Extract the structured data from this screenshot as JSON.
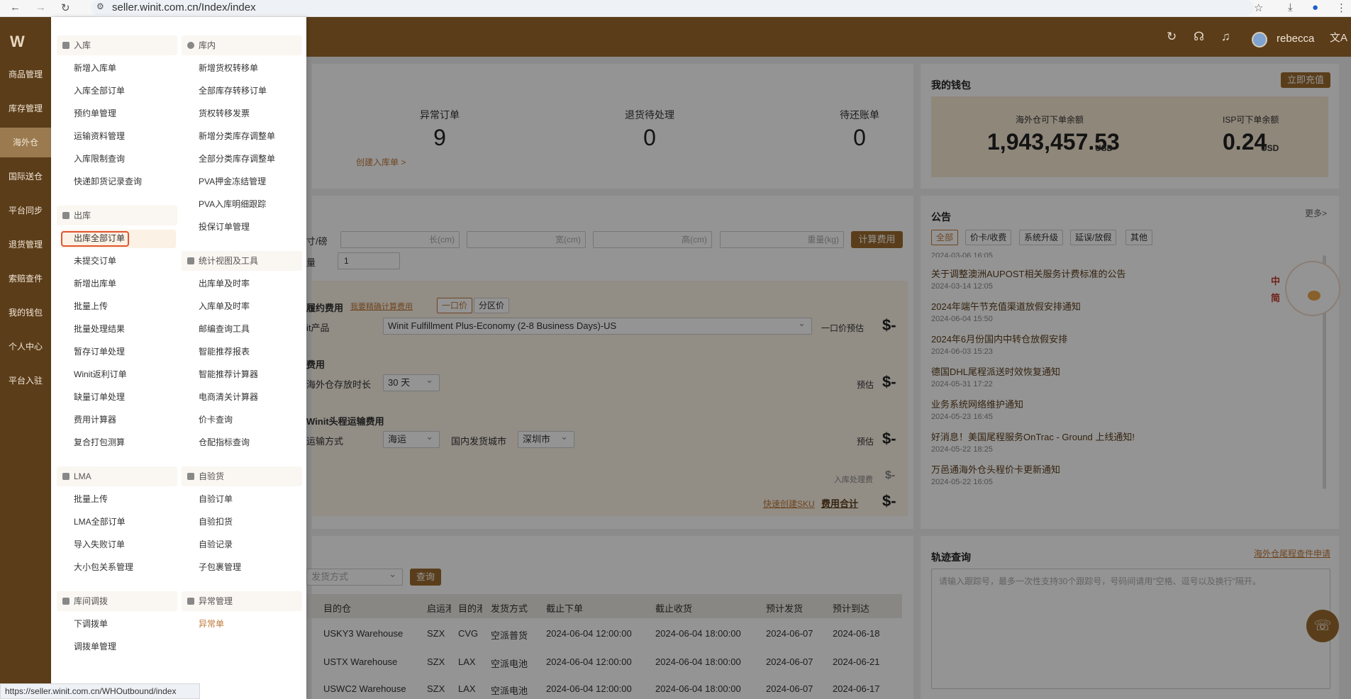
{
  "browser": {
    "url": "seller.winit.com.cn/Index/index"
  },
  "header": {
    "username": "rebecca"
  },
  "sidebar": {
    "logo": "W",
    "items": [
      {
        "label": "商品管理"
      },
      {
        "label": "库存管理"
      },
      {
        "label": "海外仓"
      },
      {
        "label": "国际送仓"
      },
      {
        "label": "平台同步"
      },
      {
        "label": "退货管理"
      },
      {
        "label": "索赔查件"
      },
      {
        "label": "我的钱包"
      },
      {
        "label": "个人中心"
      },
      {
        "label": "平台入驻"
      }
    ]
  },
  "menu": {
    "inbound": {
      "title": "入库",
      "items": [
        "新增入库单",
        "入库全部订单",
        "预约单管理",
        "运输资料管理",
        "入库限制查询",
        "快递卸货记录查询"
      ]
    },
    "stock": {
      "title": "库内",
      "items": [
        "新增货权转移单",
        "全部库存转移订单",
        "货权转移发票",
        "新增分类库存调整单",
        "全部分类库存调整单",
        "PVA押金冻结管理",
        "PVA入库明细跟踪",
        "投保订单管理"
      ]
    },
    "outbound": {
      "title": "出库",
      "items": [
        "出库全部订单",
        "未提交订单",
        "新增出库单",
        "批量上传",
        "批量处理结果",
        "暂存订单处理",
        "Winit返利订单",
        "缺量订单处理",
        "费用计算器",
        "复合打包测算"
      ]
    },
    "stats": {
      "title": "统计视图及工具",
      "items": [
        "出库单及时率",
        "入库单及时率",
        "邮编查询工具",
        "智能推荐报表",
        "智能推荐计算器",
        "电商清关计算器",
        "价卡查询",
        "仓配指标查询"
      ]
    },
    "lma": {
      "title": "LMA",
      "items": [
        "批量上传",
        "LMA全部订单",
        "导入失败订单",
        "大小包关系管理"
      ]
    },
    "selfcheck": {
      "title": "自验货",
      "items": [
        "自验订单",
        "自验扣货",
        "自验记录",
        "子包裹管理"
      ]
    },
    "transfer": {
      "title": "库间调拨",
      "items": [
        "下调拨单",
        "调拨单管理"
      ]
    },
    "exception": {
      "title": "异常管理",
      "items": [
        "异常单"
      ]
    }
  },
  "stats": {
    "items": [
      {
        "label": "异常订单",
        "value": "9"
      },
      {
        "label": "退货待处理",
        "value": "0"
      },
      {
        "label": "待还账单",
        "value": "0"
      }
    ],
    "create_link": "创建入库单 >"
  },
  "wallet": {
    "title": "我的钱包",
    "recharge": "立即充值",
    "overseas_label": "海外仓可下单余额",
    "overseas_value": "1,943,457.53",
    "isp_label": "ISP可下单余额",
    "isp_value": "0.24",
    "currency": "USD"
  },
  "calculator": {
    "dim_label": "寸/磅",
    "length_ph": "长(cm)",
    "width_ph": "宽(cm)",
    "height_ph": "高(cm)",
    "weight_ph": "重量(kg)",
    "calc_btn": "计算费用",
    "qty_label": "量",
    "qty_value": "1",
    "fulfill_title": "履约费用",
    "fulfill_link": "我要精确计算费用",
    "tab_flat": "一口价",
    "tab_zone": "分区价",
    "product_label": "it产品",
    "product_value": "Winit Fulfillment Plus-Economy (2-8 Business Days)-US",
    "flat_estimate": "一口价预估",
    "dollar": "$-",
    "storage_title": "费用",
    "storage_label": "海外仓存放时长",
    "storage_value": "30 天",
    "estimate": "预估",
    "headhaul_title": "Winit头程运输费用",
    "transport_label": "运输方式",
    "transport_value": "海运",
    "city_label": "国内发货城市",
    "city_value": "深圳市",
    "inbound_fee": "入库处理费",
    "quick_sku": "快速创建SKU",
    "total_label": "费用合计"
  },
  "announcements": {
    "title": "公告",
    "more": "更多>",
    "tabs": [
      "全部",
      "价卡/收费",
      "系统升级",
      "延误/放假",
      "其他"
    ],
    "partial_date": "2024-03-06 16:05",
    "items": [
      {
        "title": "关于调整澳洲AUPOST相关服务计费标准的公告",
        "date": "2024-03-14 12:05"
      },
      {
        "title": "2024年端午节充值渠道放假安排通知",
        "date": "2024-06-04 15:50"
      },
      {
        "title": "2024年6月份国内中转仓放假安排",
        "date": "2024-06-03 15:23"
      },
      {
        "title": "德国DHL尾程派送时效恢复通知",
        "date": "2024-05-31 17:22"
      },
      {
        "title": "业务系统网络维护通知",
        "date": "2024-05-23 16:45"
      },
      {
        "title": "好消息！美国尾程服务OnTrac - Ground 上线通知!",
        "date": "2024-05-22 18:25"
      },
      {
        "title": "万邑通海外仓头程价卡更新通知",
        "date": "2024-05-22 16:05"
      }
    ],
    "mascot_text": [
      "中",
      "简"
    ]
  },
  "orders": {
    "ship_method_ph": "发货方式",
    "query_btn": "查询",
    "headers": [
      "目的仓",
      "启运港",
      "目的港",
      "发货方式",
      "截止下单",
      "截止收货",
      "预计发货",
      "预计到达"
    ],
    "rows": [
      [
        "USKY3 Warehouse",
        "SZX",
        "CVG",
        "空派普货",
        "2024-06-04 12:00:00",
        "2024-06-04 18:00:00",
        "2024-06-07",
        "2024-06-18"
      ],
      [
        "USTX Warehouse",
        "SZX",
        "LAX",
        "空派电池",
        "2024-06-04 12:00:00",
        "2024-06-04 18:00:00",
        "2024-06-07",
        "2024-06-21"
      ],
      [
        "USWC2 Warehouse",
        "SZX",
        "LAX",
        "空派电池",
        "2024-06-04 12:00:00",
        "2024-06-04 18:00:00",
        "2024-06-07",
        "2024-06-17"
      ]
    ]
  },
  "tracking": {
    "title": "轨迹查询",
    "link": "海外仓尾程查件申请",
    "placeholder": "请输入跟踪号，最多一次性支持30个跟踪号，号码间请用\"空格、逗号以及换行\"隔开。"
  },
  "statusbar": {
    "url": "https://seller.winit.com.cn/WHOutbound/index"
  },
  "colors": {
    "brand": "#5b3d1a",
    "accent": "#9b6b2f",
    "link": "#c0793a"
  }
}
